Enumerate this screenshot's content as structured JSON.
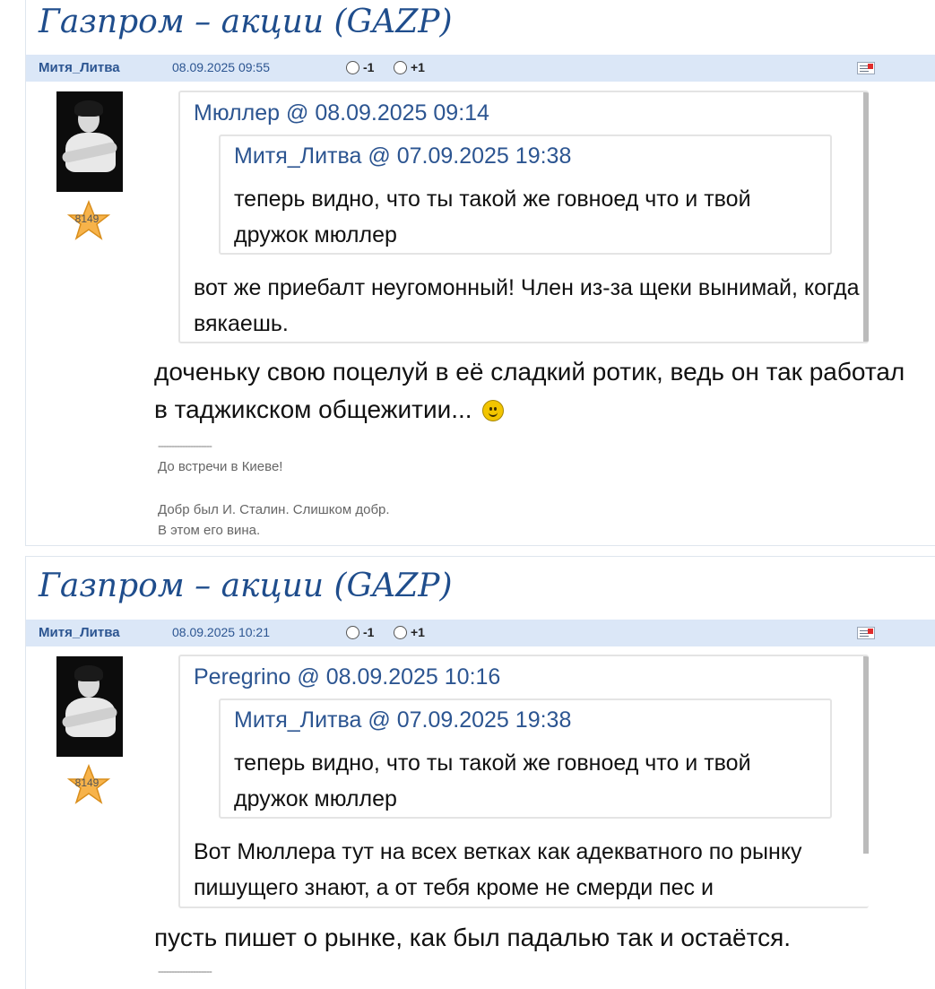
{
  "posts": [
    {
      "thread_title": "Газпром – акции (GAZP)",
      "author": "Митя_Литва",
      "date": "08.09.2025 09:55",
      "vote_minus": "-1",
      "vote_plus": "+1",
      "rating": "8149",
      "quote": {
        "author": "Мюллер",
        "at": "@",
        "date": "08.09.2025 09:14",
        "nested": {
          "author": "Митя_Литва",
          "at": "@",
          "date": "07.09.2025 19:38",
          "text": "теперь видно, что ты такой же говноед что и твой дружок мюллер"
        },
        "text": "вот же приебалт неугомонный! Член из-за щеки вынимай, когда вякаешь."
      },
      "text": "доченьку свою поцелуй в её сладкий ротик, ведь он так работал в таджикском общежитии...",
      "smiley": "smiley-icon",
      "sig_line": "--------------------",
      "sig1": "До встречи в Киеве!",
      "sig2": "Добр был И. Сталин. Слишком добр.",
      "sig3": "В этом его вина."
    },
    {
      "thread_title": "Газпром – акции (GAZP)",
      "author": "Митя_Литва",
      "date": "08.09.2025 10:21",
      "vote_minus": "-1",
      "vote_plus": "+1",
      "rating": "8149",
      "quote": {
        "author": "Peregrino",
        "at": "@",
        "date": "08.09.2025 10:16",
        "nested": {
          "author": "Митя_Литва",
          "at": "@",
          "date": "07.09.2025 19:38",
          "text": "теперь видно, что ты такой же говноед что и твой дружок мюллер"
        },
        "text": "Вот Мюллера тут на всех ветках как адекватного по рынку пишущего знают, а от тебя кроме не смерди пес и"
      },
      "text": "пусть пишет о рынке, как был падалью так и остаётся.",
      "sig_line": "--------------------"
    }
  ]
}
